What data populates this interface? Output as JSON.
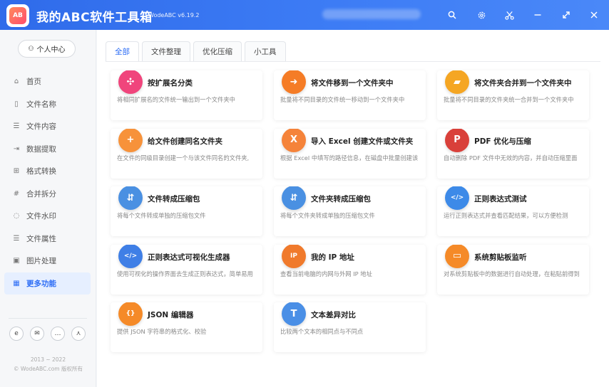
{
  "app": {
    "title": "我的ABC软件工具箱",
    "version": "WodeABC v6.19.2",
    "logo_text": "AB"
  },
  "titlebar": {
    "icons": [
      "search-icon",
      "gear-icon",
      "scissors-icon",
      "minimize-icon",
      "maximize-icon",
      "close-icon"
    ]
  },
  "sidebar": {
    "user_center": "个人中心",
    "items": [
      {
        "label": "首页",
        "icon": "home-icon"
      },
      {
        "label": "文件名称",
        "icon": "file-name-icon"
      },
      {
        "label": "文件内容",
        "icon": "file-content-icon"
      },
      {
        "label": "数据提取",
        "icon": "data-extract-icon"
      },
      {
        "label": "格式转换",
        "icon": "format-convert-icon"
      },
      {
        "label": "合并拆分",
        "icon": "merge-split-icon"
      },
      {
        "label": "文件水印",
        "icon": "watermark-icon"
      },
      {
        "label": "文件属性",
        "icon": "file-attr-icon"
      },
      {
        "label": "图片处理",
        "icon": "image-icon"
      },
      {
        "label": "更多功能",
        "icon": "more-icon"
      }
    ],
    "active_index": 9,
    "social": [
      "ie-icon",
      "mail-icon",
      "chat-icon",
      "share-icon"
    ],
    "copyright_years": "2013 ~ 2022",
    "copyright_text": "© WodeABC.com 版权所有"
  },
  "tabs": [
    {
      "label": "全部"
    },
    {
      "label": "文件整理"
    },
    {
      "label": "优化压缩"
    },
    {
      "label": "小工具"
    }
  ],
  "active_tab": 0,
  "cards": [
    {
      "title": "按扩展名分类",
      "desc": "将相同扩展名的文件统一输出到一个文件夹中",
      "icon": "puzzle-icon",
      "color": "#f0457c"
    },
    {
      "title": "将文件移到一个文件夹中",
      "desc": "批量将不同目录的文件统一移动到一个文件夹中",
      "icon": "folder-move-icon",
      "color": "#f57c26"
    },
    {
      "title": "将文件夹合并到一个文件夹中",
      "desc": "批量将不同目录的文件夹统一合并到一个文件夹中",
      "icon": "folder-merge-icon",
      "color": "#f5a623"
    },
    {
      "title": "给文件创建同名文件夹",
      "desc": "在文件的同级目录创建一个与该文件同名的文件夹,",
      "icon": "folder-add-icon",
      "color": "#f7923a"
    },
    {
      "title": "导入 Excel 创建文件或文件夹",
      "desc": "根据 Excel 中填写的路径信息，在磁盘中批量创建该",
      "icon": "excel-icon",
      "color": "#f5833a"
    },
    {
      "title": "PDF 优化与压缩",
      "desc": "自动删除 PDF 文件中无效的内容，并自动压缩里面",
      "icon": "pdf-icon",
      "color": "#d9403a"
    },
    {
      "title": "文件转成压缩包",
      "desc": "将每个文件转成单独的压缩包文件",
      "icon": "file-zip-icon",
      "color": "#4a90e2"
    },
    {
      "title": "文件夹转成压缩包",
      "desc": "将每个文件夹转成单独的压缩包文件",
      "icon": "folder-zip-icon",
      "color": "#4a90e2"
    },
    {
      "title": "正则表达式测试",
      "desc": "运行正则表达式并查看匹配结果，可以方便检测",
      "icon": "regex-icon",
      "color": "#3d8ae8"
    },
    {
      "title": "正则表达式可视化生成器",
      "desc": "使用可视化的操作界面去生成正则表达式，简单易用",
      "icon": "code-window-icon",
      "color": "#3f7fe6"
    },
    {
      "title": "我的 IP 地址",
      "desc": "查看当前电脑的内网与外网 IP 地址",
      "icon": "ip-icon",
      "color": "#f07a2c"
    },
    {
      "title": "系统剪贴板监听",
      "desc": "对系统剪贴板中的数据进行自动处理，在粘贴前得到",
      "icon": "clipboard-icon",
      "color": "#f58a28"
    },
    {
      "title": "JSON 编辑器",
      "desc": "提供 JSON 字符串的格式化、校验",
      "icon": "json-icon",
      "color": "#f58a28"
    },
    {
      "title": "文本差异对比",
      "desc": "比较两个文本的相同点与不同点",
      "icon": "text-diff-icon",
      "color": "#4a8fe6"
    }
  ]
}
